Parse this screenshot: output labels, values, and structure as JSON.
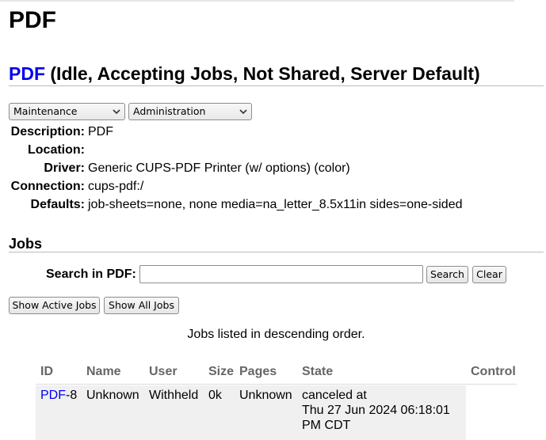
{
  "page": {
    "title": "PDF"
  },
  "printer": {
    "name_link": "PDF",
    "status": " (Idle, Accepting Jobs, Not Shared, Server Default)"
  },
  "menus": {
    "maintenance": "Maintenance",
    "administration": "Administration"
  },
  "info": {
    "labels": {
      "description": "Description:",
      "location": "Location:",
      "driver": "Driver:",
      "connection": "Connection:",
      "defaults": "Defaults:"
    },
    "values": {
      "description": "PDF",
      "location": "",
      "driver": "Generic CUPS-PDF Printer (w/ options) (color)",
      "connection": "cups-pdf:/",
      "defaults": "job-sheets=none, none media=na_letter_8.5x11in sides=one-sided"
    }
  },
  "jobs": {
    "heading": "Jobs",
    "search_label": "Search in PDF:",
    "search_value": "",
    "search_button": "Search",
    "clear_button": "Clear",
    "show_active_button": "Show Active Jobs",
    "show_all_button": "Show All Jobs",
    "order_note": "Jobs listed in descending order.",
    "columns": {
      "id": "ID",
      "name": "Name",
      "user": "User",
      "size": "Size",
      "pages": "Pages",
      "state": "State",
      "control": "Control"
    },
    "rows": [
      {
        "id_link": "PDF",
        "id_suffix": "-8",
        "name": "Unknown",
        "user": "Withheld",
        "size": "0k",
        "pages": "Unknown",
        "state_line1": "canceled at",
        "state_line2": "Thu 27 Jun 2024 06:18:01",
        "state_line3": "PM CDT",
        "control": ""
      }
    ]
  },
  "colors": {
    "link": "#0000ee",
    "header_text": "#666666",
    "row_bg": "#f0f0f0"
  }
}
